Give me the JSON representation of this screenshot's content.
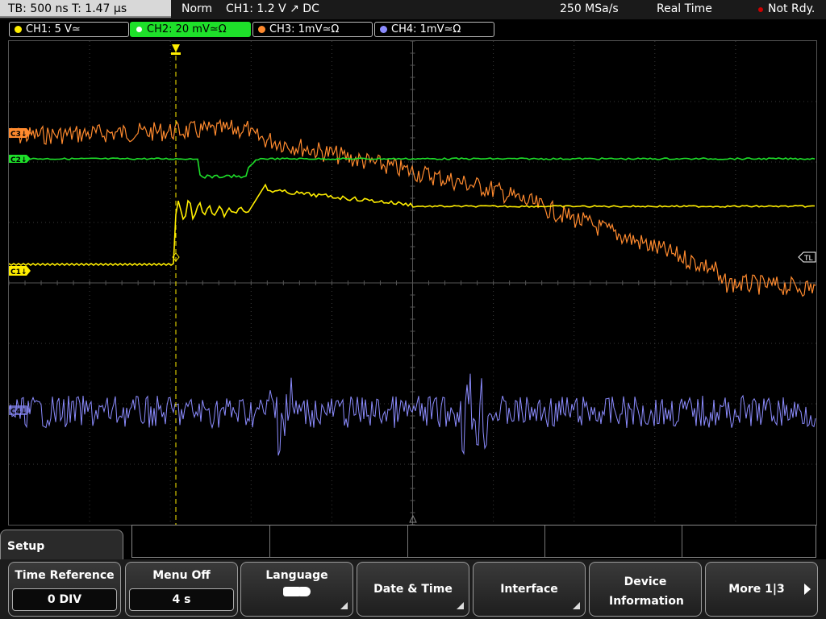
{
  "status": {
    "timebase": "TB: 500 ns   T: 1.47 µs",
    "trigger_mode": "Norm",
    "trigger_info": "CH1: 1.2 V ↗ DC",
    "sample_rate": "250 MSa/s",
    "acq_mode": "Real Time",
    "state": "Not Rdy."
  },
  "channels": [
    {
      "label": "CH1: 5 V≃",
      "color": "#ffee00"
    },
    {
      "label": "CH2: 20 mV≃Ω",
      "color": "#1ee02a"
    },
    {
      "label": "CH3: 1mV≃Ω",
      "color": "#ff8a2e"
    },
    {
      "label": "CH4: 1mV≃Ω",
      "color": "#8c8cff"
    }
  ],
  "markers": {
    "ch3": "C3↓",
    "ch2": "C2↓",
    "ch1": "C1↓",
    "ch4": "C4↓",
    "trigger_level": "TL"
  },
  "menu": {
    "title": "Setup",
    "softkeys": [
      {
        "label": "Time Reference",
        "value": "0 DIV"
      },
      {
        "label": "Menu Off",
        "value": "4 s"
      },
      {
        "label": "Language",
        "icon": "speech-bubbles-icon"
      },
      {
        "label": "Date & Time"
      },
      {
        "label": "Interface"
      },
      {
        "label": "Device Information"
      },
      {
        "label": "More 1|3"
      }
    ]
  }
}
